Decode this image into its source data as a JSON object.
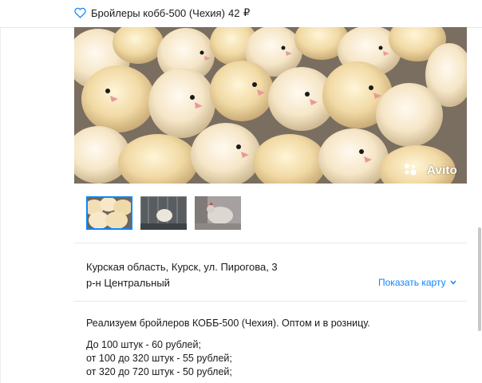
{
  "header": {
    "title": "Бройлеры кобб-500 (Чехия)",
    "price": "42",
    "currency": "₽",
    "favorite_icon": "heart-outline-icon",
    "accent": "#0a87ff"
  },
  "gallery": {
    "watermark": "Avito",
    "thumbnails": [
      {
        "name": "thumbnail-chicks",
        "selected": true
      },
      {
        "name": "thumbnail-cage",
        "selected": false
      },
      {
        "name": "thumbnail-hen",
        "selected": false
      }
    ]
  },
  "location": {
    "address": "Курская область, Курск, ул. Пирогова, 3",
    "district": "р-н Центральный",
    "show_map": "Показать карту"
  },
  "description": {
    "intro": "Реализуем бройлеров КОББ-500 (Чехия). Оптом и в розницу.",
    "lines": [
      "До 100 штук - 60 рублей;",
      "от 100 до 320 штук - 55 рублей;",
      "от 320 до 720 штук - 50 рублей;"
    ]
  }
}
